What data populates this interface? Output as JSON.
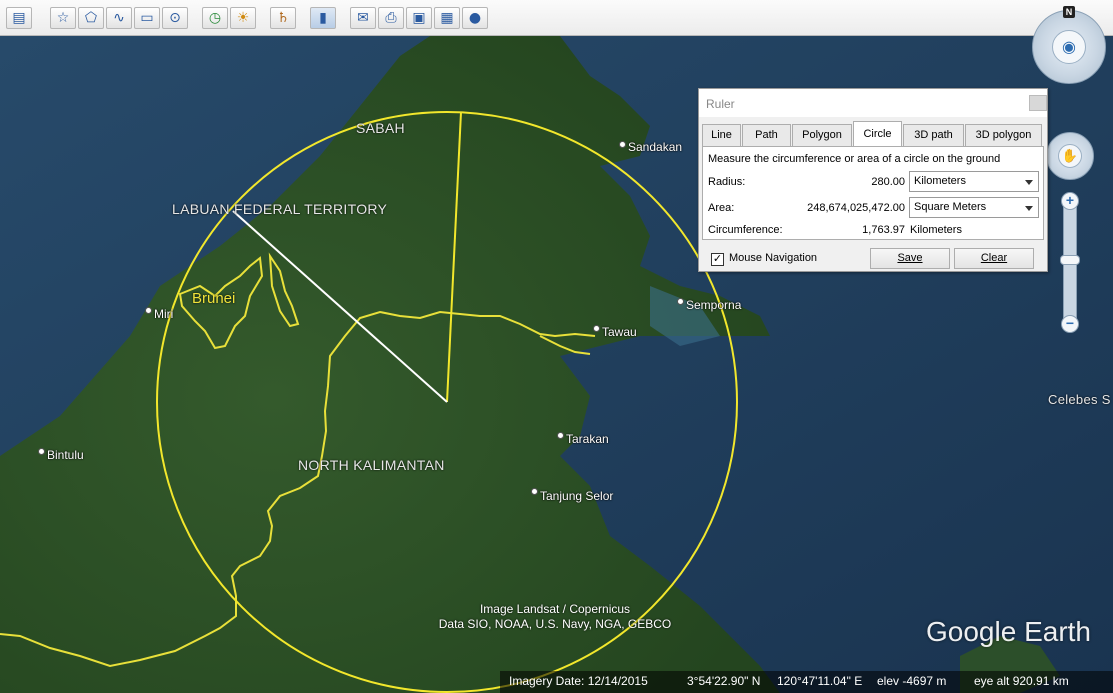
{
  "toolbar": {
    "buttons": [
      {
        "name": "sidebar-toggle-button",
        "glyph": "▤"
      },
      {
        "name": "add-placemark-button",
        "glyph": "☆"
      },
      {
        "name": "add-polygon-button",
        "glyph": "⬠"
      },
      {
        "name": "add-path-button",
        "glyph": "∿"
      },
      {
        "name": "add-image-overlay-button",
        "glyph": "▭"
      },
      {
        "name": "record-tour-button",
        "glyph": "⊙"
      },
      {
        "name": "historical-imagery-button",
        "glyph": "◷"
      },
      {
        "name": "sunlight-button",
        "glyph": "☀"
      },
      {
        "name": "switch-planet-button",
        "glyph": "♄"
      },
      {
        "name": "ruler-button",
        "glyph": "▮"
      },
      {
        "name": "email-button",
        "glyph": "✉"
      },
      {
        "name": "print-button",
        "glyph": "⎙"
      },
      {
        "name": "save-image-button",
        "glyph": "▣"
      },
      {
        "name": "view-in-maps-button",
        "glyph": "▦"
      },
      {
        "name": "sign-in-button",
        "glyph": "●"
      }
    ]
  },
  "map": {
    "regions": {
      "sabah": "SABAH",
      "labuan": "LABUAN FEDERAL TERRITORY",
      "north_kalimantan": "NORTH KALIMANTAN"
    },
    "country": "Brunei",
    "places": {
      "sandakan": "Sandakan",
      "semporna": "Semporna",
      "tawau": "Tawau",
      "miri": "Miri",
      "bintulu": "Bintulu",
      "tarakan": "Tarakan",
      "tanjung_selor": "Tanjung Selor",
      "celebes": "Celebes S"
    },
    "attribution": [
      "Image Landsat / Copernicus",
      "Data SIO, NOAA, U.S. Navy, NGA, GEBCO"
    ],
    "logo": "Google Earth",
    "colors": {
      "circle": "#f2e72c",
      "border": "#e8e03a",
      "radius_line": "#ffffff"
    }
  },
  "status": {
    "imagery_date": "Imagery Date: 12/14/2015",
    "lat": "3°54'22.90\" N",
    "lon": "120°47'11.04\" E",
    "elev": "elev -4697 m",
    "eye_alt": "eye alt 920.91 km"
  },
  "nav": {
    "north": "N",
    "zoom_in": "+",
    "zoom_out": "−"
  },
  "ruler": {
    "title": "Ruler",
    "tabs": [
      "Line",
      "Path",
      "Polygon",
      "Circle",
      "3D path",
      "3D polygon"
    ],
    "active_tab": "Circle",
    "description": "Measure the circumference or area of a circle on the ground",
    "radius_label": "Radius:",
    "radius_value": "280.00",
    "radius_unit": "Kilometers",
    "area_label": "Area:",
    "area_value": "248,674,025,472.00",
    "area_unit": "Square Meters",
    "circ_label": "Circumference:",
    "circ_value": "1,763.97",
    "circ_unit": "Kilometers",
    "mouse_nav_label": "Mouse Navigation",
    "mouse_nav_checked": "✓",
    "save_label": "Save",
    "clear_label": "Clear"
  }
}
